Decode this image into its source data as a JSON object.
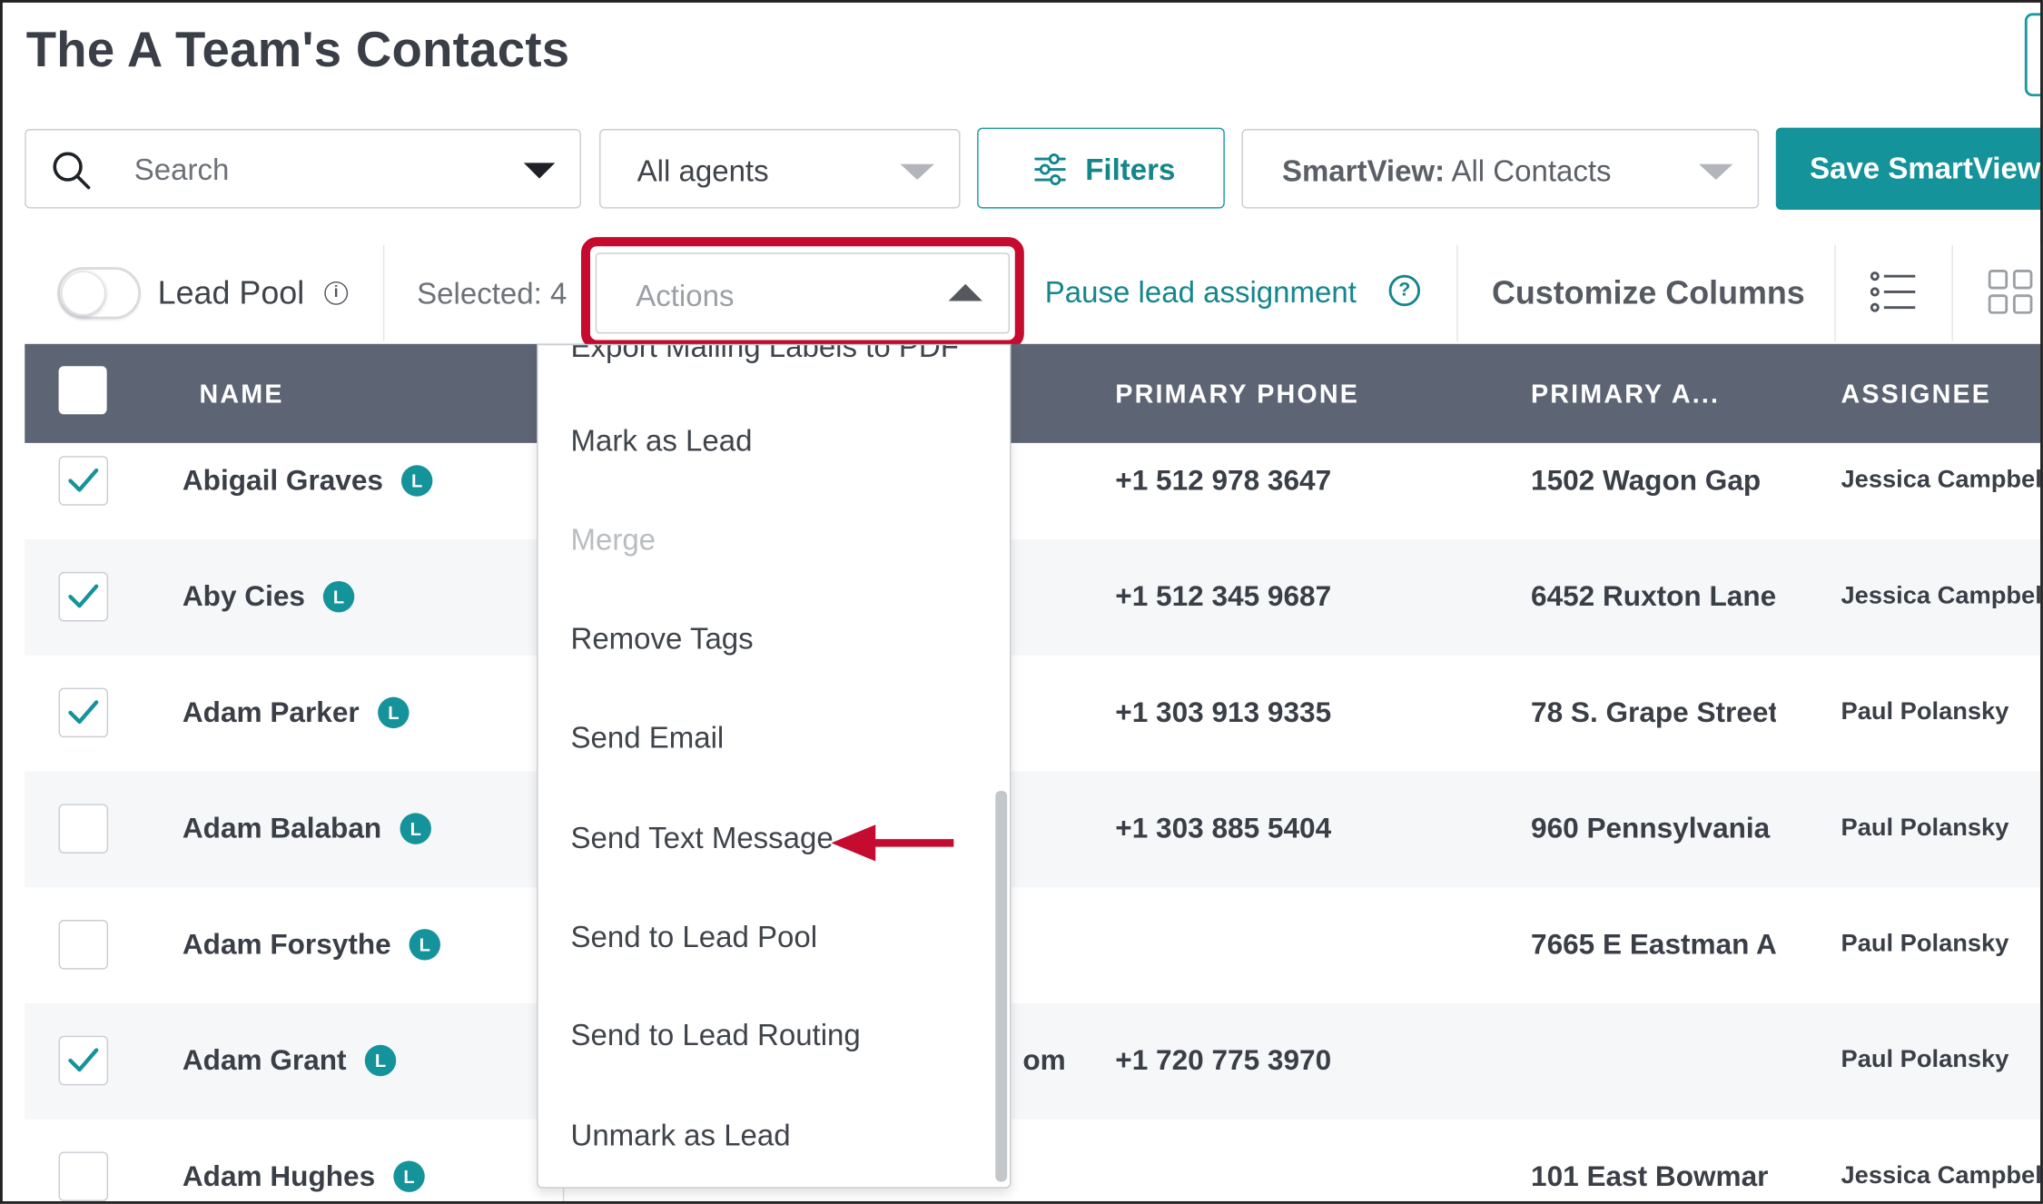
{
  "page": {
    "title": "The A Team's Contacts"
  },
  "toolbar": {
    "search_placeholder": "Search",
    "agents_label": "All agents",
    "filters_label": "Filters",
    "smartview_prefix": "SmartView:",
    "smartview_value": "All Contacts",
    "save_label": "Save SmartView"
  },
  "subbar": {
    "lead_pool_label": "Lead Pool",
    "info_glyph": "i",
    "selected_label": "Selected: 4",
    "actions_placeholder": "Actions",
    "pause_label": "Pause lead assignment",
    "help_glyph": "?",
    "customize_label": "Customize Columns"
  },
  "table": {
    "columns": {
      "name": "NAME",
      "phone": "PRIMARY PHONE",
      "address": "PRIMARY A...",
      "assignee": "ASSIGNEE"
    },
    "badge": "L",
    "rows": [
      {
        "checked": true,
        "name": "Abigail Graves",
        "phone": "+1 512 978 3647",
        "address": "1502 Wagon Gap",
        "assignee": "Jessica Campbell",
        "email_fragment": ""
      },
      {
        "checked": true,
        "name": "Aby Cies",
        "phone": "+1 512 345 9687",
        "address": "6452 Ruxton Lane",
        "assignee": "Jessica Campbell",
        "email_fragment": ""
      },
      {
        "checked": true,
        "name": "Adam Parker",
        "phone": "+1 303 913 9335",
        "address": "78 S. Grape Street",
        "assignee": "Paul Polansky",
        "email_fragment": ""
      },
      {
        "checked": false,
        "name": "Adam Balaban",
        "phone": "+1 303 885 5404",
        "address": "960 Pennsylvania",
        "assignee": "Paul Polansky",
        "email_fragment": ""
      },
      {
        "checked": false,
        "name": "Adam Forsythe",
        "phone": "",
        "address": "7665 E Eastman A",
        "assignee": "Paul Polansky",
        "email_fragment": ""
      },
      {
        "checked": true,
        "name": "Adam Grant",
        "phone": "+1 720 775 3970",
        "address": "",
        "assignee": "Paul Polansky",
        "email_fragment": "om"
      },
      {
        "checked": false,
        "name": "Adam Hughes",
        "phone": "",
        "address": "101 East Bowmar",
        "assignee": "Jessica Campbell",
        "email_fragment": ""
      }
    ]
  },
  "actions_menu": {
    "partial_top_item": "Export Mailing Labels to PDF",
    "items": [
      {
        "label": "Mark as Lead",
        "disabled": false
      },
      {
        "label": "Merge",
        "disabled": true
      },
      {
        "label": "Remove Tags",
        "disabled": false
      },
      {
        "label": "Send Email",
        "disabled": false
      },
      {
        "label": "Send Text Message",
        "disabled": false
      },
      {
        "label": "Send to Lead Pool",
        "disabled": false
      },
      {
        "label": "Send to Lead Routing",
        "disabled": false
      },
      {
        "label": "Unmark as Lead",
        "disabled": false
      }
    ]
  },
  "annotations": {
    "highlight_color": "#c50b2f",
    "arrow_target": "Send Text Message"
  },
  "colors": {
    "accent": "#15939a",
    "header_bg": "#5d6473"
  }
}
